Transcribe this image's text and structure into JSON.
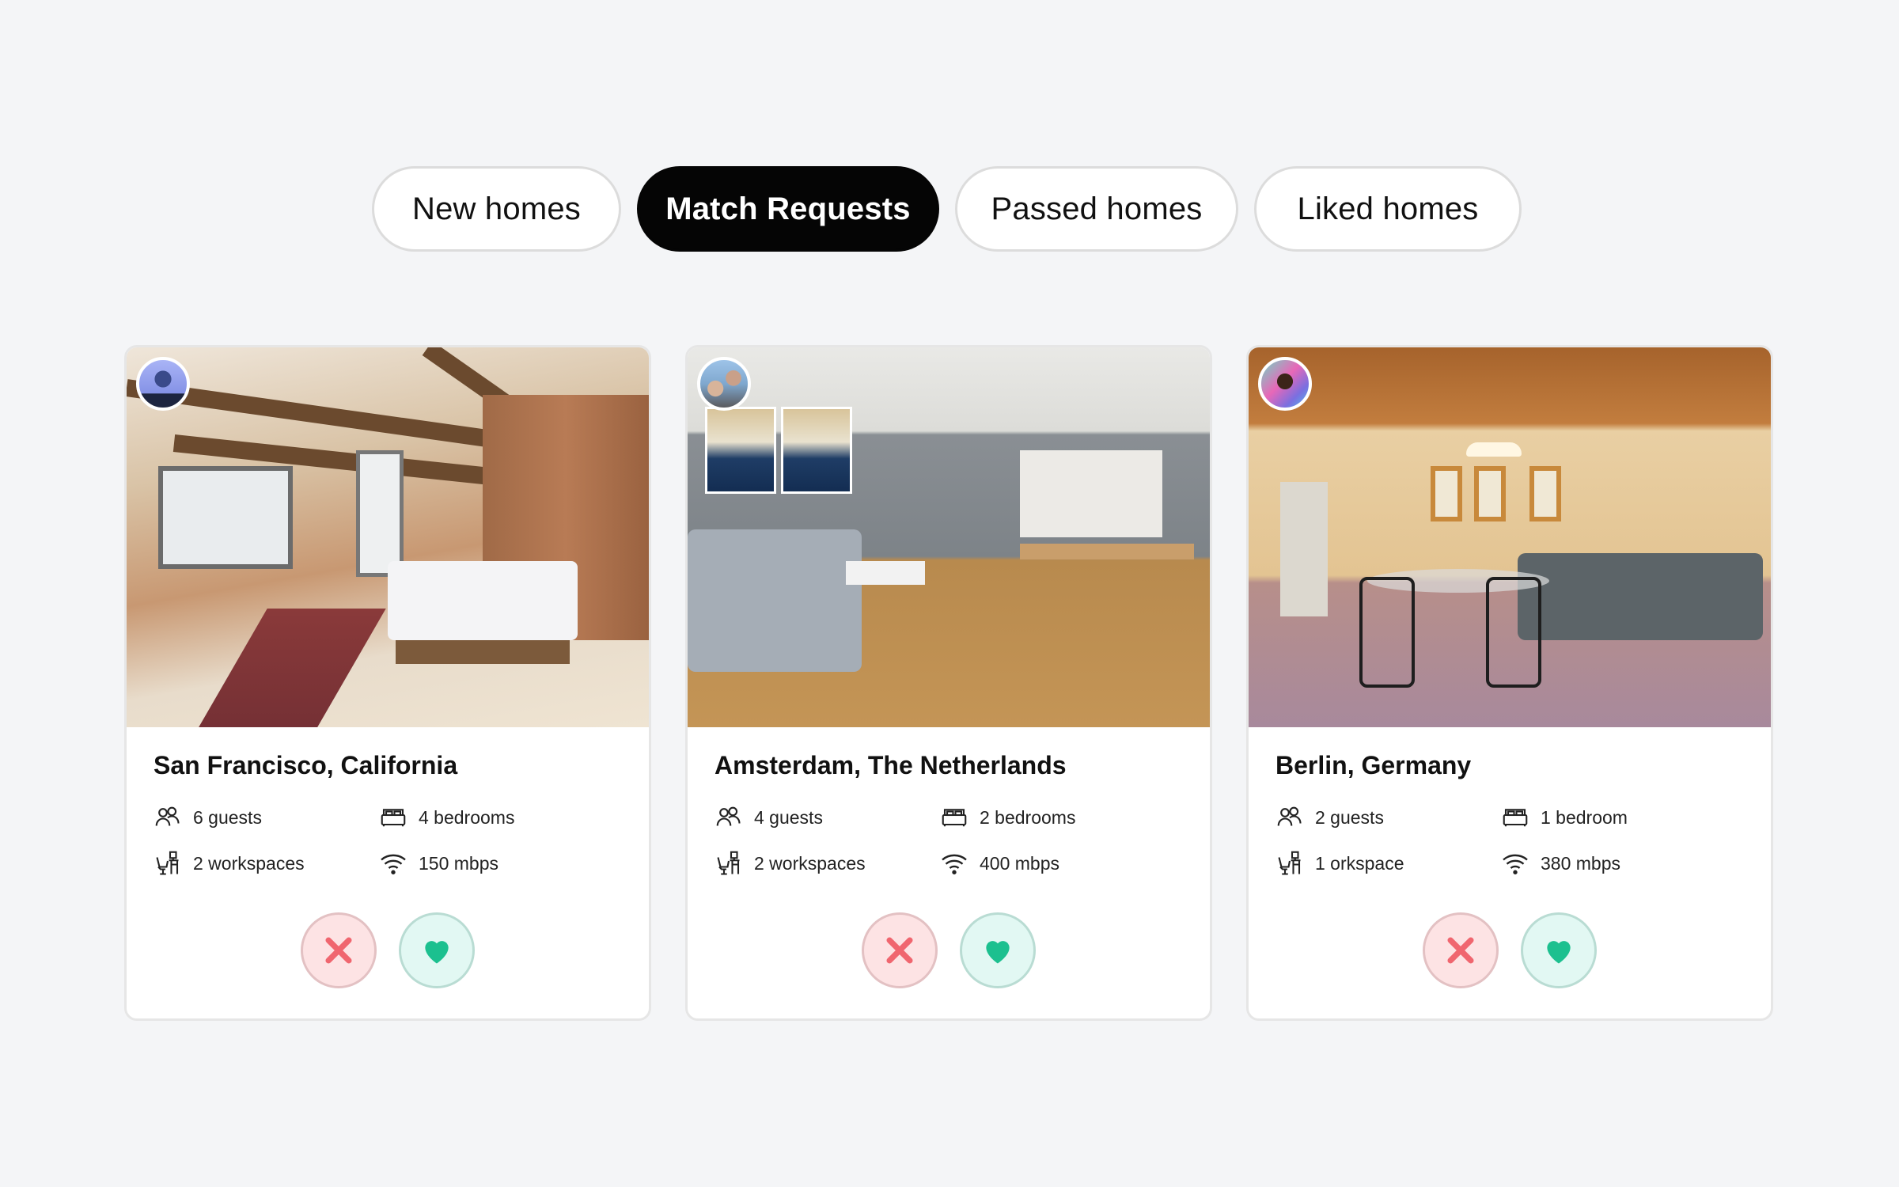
{
  "tabs": [
    {
      "label": "New homes",
      "active": false
    },
    {
      "label": "Match Requests",
      "active": true
    },
    {
      "label": "Passed homes",
      "active": false
    },
    {
      "label": "Liked homes",
      "active": false
    }
  ],
  "colors": {
    "background": "#f4f5f7",
    "active_tab": "#050505",
    "pass_bg": "#fde3e4",
    "pass_icon": "#f0666f",
    "like_bg": "#e2f8f3",
    "like_icon": "#1cc08f"
  },
  "cards": [
    {
      "location": "San Francisco, California",
      "photo": "rustic loft bedroom with exposed brick and wooden beams",
      "avatar": "host-avatar",
      "guests": "6 guests",
      "bedrooms": "4 bedrooms",
      "workspaces": "2 workspaces",
      "wifi": "150 mbps"
    },
    {
      "location": "Amsterdam, The Netherlands",
      "photo": "modern living room with grey sofa and wooden floor",
      "avatar": "host-avatar",
      "guests": "4 guests",
      "bedrooms": "2 bedrooms",
      "workspaces": "2 workspaces",
      "wifi": "400 mbps"
    },
    {
      "location": "Berlin, Germany",
      "photo": "warm open kitchen with wooden ceiling and dining table",
      "avatar": "host-avatar",
      "guests": "2 guests",
      "bedrooms": "1 bedroom",
      "workspaces": "1 orkspace",
      "wifi": "380 mbps"
    }
  ],
  "icons": {
    "guests": "users-icon",
    "bedrooms": "bed-icon",
    "workspaces": "workspace-desk-icon",
    "wifi": "wifi-icon",
    "pass": "x-icon",
    "like": "heart-icon"
  }
}
